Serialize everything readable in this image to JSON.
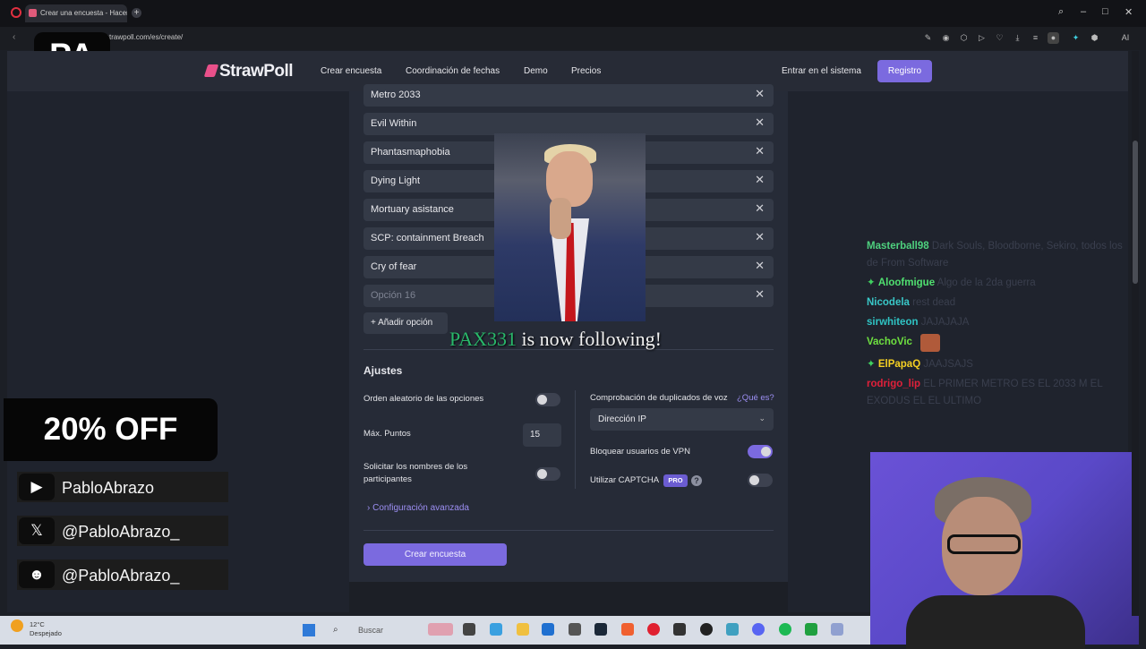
{
  "browser": {
    "tab_title": "Crear una encuesta - Hacer",
    "url": "strawpoll.com/es/create/",
    "window_controls": [
      "search-icon",
      "minimize-icon",
      "maximize-icon",
      "close-icon"
    ]
  },
  "overlay_pa": "PA",
  "site": {
    "logo": "StrawPoll",
    "nav": [
      "Crear encuesta",
      "Coordinación de fechas",
      "Demo",
      "Precios"
    ],
    "login": "Entrar en el sistema",
    "register": "Registro"
  },
  "options": [
    {
      "label": "Metro 2033",
      "placeholder": false
    },
    {
      "label": "Evil Within",
      "placeholder": false
    },
    {
      "label": "Phantasmaphobia",
      "placeholder": false
    },
    {
      "label": "Dying Light",
      "placeholder": false
    },
    {
      "label": "Mortuary asistance",
      "placeholder": false
    },
    {
      "label": "SCP: containment Breach",
      "placeholder": false
    },
    {
      "label": "Cry of fear",
      "placeholder": false
    },
    {
      "label": "Opción 16",
      "placeholder": true
    }
  ],
  "add_option": "Añadir opción",
  "settings": {
    "title": "Ajustes",
    "random_order": {
      "label": "Orden aleatorio de las opciones",
      "on": false
    },
    "max_points": {
      "label": "Máx. Puntos",
      "value": "15"
    },
    "require_names": {
      "label": "Solicitar los nombres de los participantes",
      "on": false
    },
    "duplicate_check": {
      "label": "Comprobación de duplicados de voz",
      "help": "¿Qué es?",
      "value": "Dirección IP"
    },
    "block_vpn": {
      "label": "Bloquear usuarios de VPN",
      "on": true
    },
    "captcha": {
      "label": "Utilizar CAPTCHA",
      "badge": "PRO",
      "help": "?",
      "on": false
    },
    "advanced": "Configuración avanzada"
  },
  "create_button": "Crear encuesta",
  "stream": {
    "follow_name": "PAX331",
    "follow_text": "is now following!",
    "sale": "20% OFF",
    "socials": [
      {
        "icon": "youtube-icon",
        "handle": "PabloAbrazo"
      },
      {
        "icon": "x-icon",
        "handle": "@PabloAbrazo_"
      },
      {
        "icon": "discord-icon",
        "handle": "@PabloAbrazo_"
      }
    ],
    "chat": [
      {
        "user": "Masterball98",
        "color": "#4ed07e",
        "badge": "",
        "msg": "Dark Souls, Bloodborne, Sekiro, todos los de From Software"
      },
      {
        "user": "Aloofmigue",
        "color": "#50e070",
        "badge": "✦",
        "msg": "Algo de la 2da guerra"
      },
      {
        "user": "Nicodela",
        "color": "#39c8c8",
        "badge": "",
        "msg": "rest dead"
      },
      {
        "user": "sirwhiteon",
        "color": "#2fc4c4",
        "badge": "",
        "msg": "JAJAJAJA"
      },
      {
        "user": "VachoVic",
        "color": "#6ee040",
        "badge": "",
        "msg": ""
      },
      {
        "user": "ElPapaQ",
        "color": "#f5d023",
        "badge": "✦",
        "msg": "JAAJSAJS"
      },
      {
        "user": "rodrigo_lip",
        "color": "#e0203a",
        "badge": "",
        "msg": "EL PRIMER METRO ES EL 2033 M EL EXODUS EL EL ULTIMO"
      }
    ]
  },
  "taskbar": {
    "temp": "12°C",
    "weather": "Despejado",
    "search": "Buscar"
  }
}
